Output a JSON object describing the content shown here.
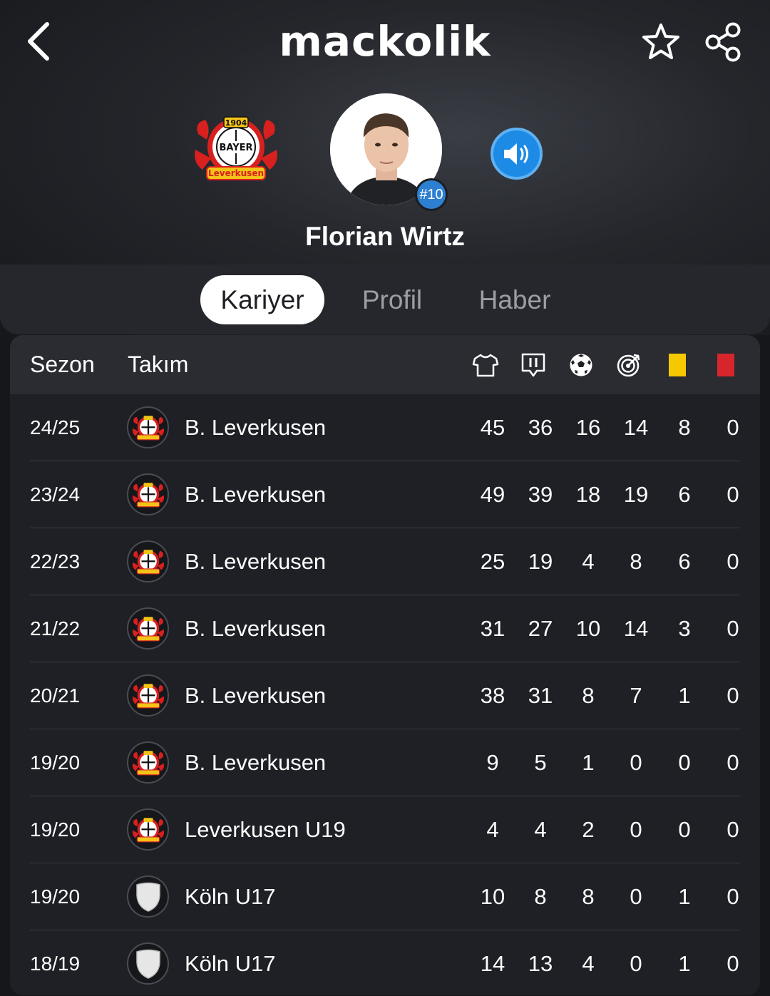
{
  "app": {
    "logo_text": "mackolik"
  },
  "header": {
    "back_icon": "chevron-left-icon",
    "favorite_icon": "star-outline-icon",
    "share_icon": "share-icon"
  },
  "player": {
    "name": "Florian Wirtz",
    "shirt_number": "#10",
    "club_logo_text": {
      "year": "1904",
      "brand": "BAYER",
      "city": "Leverkusen"
    },
    "audio_icon": "speaker-icon",
    "colors": {
      "badge": "#2d7fd1",
      "audio": "#1d8be6"
    }
  },
  "tabs": [
    {
      "label": "Kariyer",
      "active": true
    },
    {
      "label": "Profil",
      "active": false
    },
    {
      "label": "Haber",
      "active": false
    }
  ],
  "table": {
    "headers": {
      "season": "Sezon",
      "team": "Takım"
    },
    "stat_columns": [
      {
        "icon": "shirt-icon",
        "meaning": "appearances"
      },
      {
        "icon": "starting-eleven-icon",
        "meaning": "starts"
      },
      {
        "icon": "ball-icon",
        "meaning": "goals"
      },
      {
        "icon": "target-icon",
        "meaning": "assists"
      },
      {
        "icon": "yellow-card-icon",
        "meaning": "yellow cards",
        "color": "#f5c800"
      },
      {
        "icon": "red-card-icon",
        "meaning": "red cards",
        "color": "#d6262b"
      }
    ],
    "rows": [
      {
        "season": "24/25",
        "team": "B. Leverkusen",
        "crest": "leverkusen",
        "stats": [
          "45",
          "36",
          "16",
          "14",
          "8",
          "0"
        ]
      },
      {
        "season": "23/24",
        "team": "B. Leverkusen",
        "crest": "leverkusen",
        "stats": [
          "49",
          "39",
          "18",
          "19",
          "6",
          "0"
        ]
      },
      {
        "season": "22/23",
        "team": "B. Leverkusen",
        "crest": "leverkusen",
        "stats": [
          "25",
          "19",
          "4",
          "8",
          "6",
          "0"
        ]
      },
      {
        "season": "21/22",
        "team": "B. Leverkusen",
        "crest": "leverkusen",
        "stats": [
          "31",
          "27",
          "10",
          "14",
          "3",
          "0"
        ]
      },
      {
        "season": "20/21",
        "team": "B. Leverkusen",
        "crest": "leverkusen",
        "stats": [
          "38",
          "31",
          "8",
          "7",
          "1",
          "0"
        ]
      },
      {
        "season": "19/20",
        "team": "B. Leverkusen",
        "crest": "leverkusen",
        "stats": [
          "9",
          "5",
          "1",
          "0",
          "0",
          "0"
        ]
      },
      {
        "season": "19/20",
        "team": "Leverkusen U19",
        "crest": "leverkusen",
        "stats": [
          "4",
          "4",
          "2",
          "0",
          "0",
          "0"
        ]
      },
      {
        "season": "19/20",
        "team": "Köln U17",
        "crest": "blank-shield",
        "stats": [
          "10",
          "8",
          "8",
          "0",
          "1",
          "0"
        ]
      },
      {
        "season": "18/19",
        "team": "Köln U17",
        "crest": "blank-shield",
        "stats": [
          "14",
          "13",
          "4",
          "0",
          "1",
          "0"
        ]
      }
    ]
  }
}
